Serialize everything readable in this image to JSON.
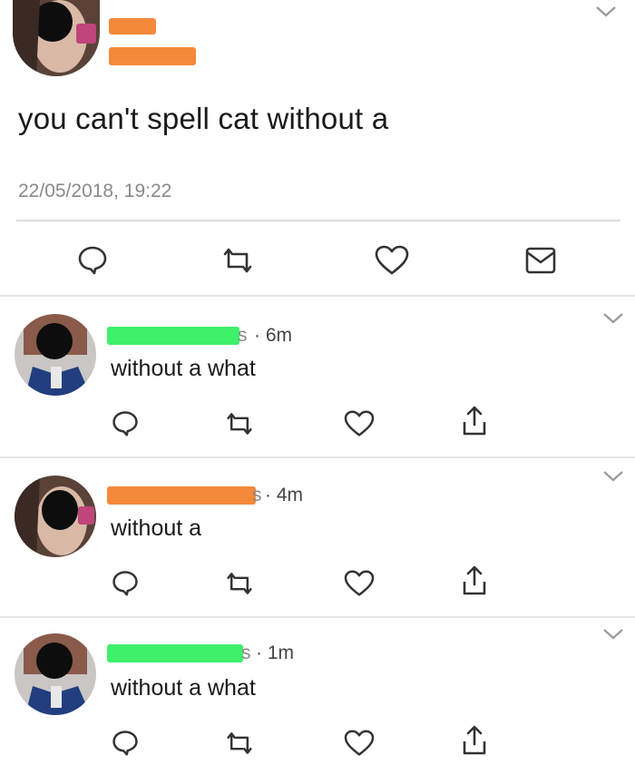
{
  "tweet": {
    "text": "you can't spell cat without a",
    "timestamp": "22/05/2018, 19:22",
    "actions": [
      "reply-icon",
      "retweet-icon",
      "like-icon",
      "message-icon"
    ]
  },
  "replies": [
    {
      "name_suffix": "s",
      "time": "· 6m",
      "text": "without a what",
      "redaction_color": "#3ef06a"
    },
    {
      "name_suffix": "s",
      "time": "· 4m",
      "text": "without a",
      "redaction_color": "#f5893a"
    },
    {
      "name_suffix": "s",
      "time": "· 1m",
      "text": "without a what",
      "redaction_color": "#3ef06a"
    }
  ],
  "colors": {
    "redact_orange": "#f5893a",
    "redact_green": "#3ef06a",
    "icon": "#333333",
    "muted_text": "#8a8a8a"
  }
}
